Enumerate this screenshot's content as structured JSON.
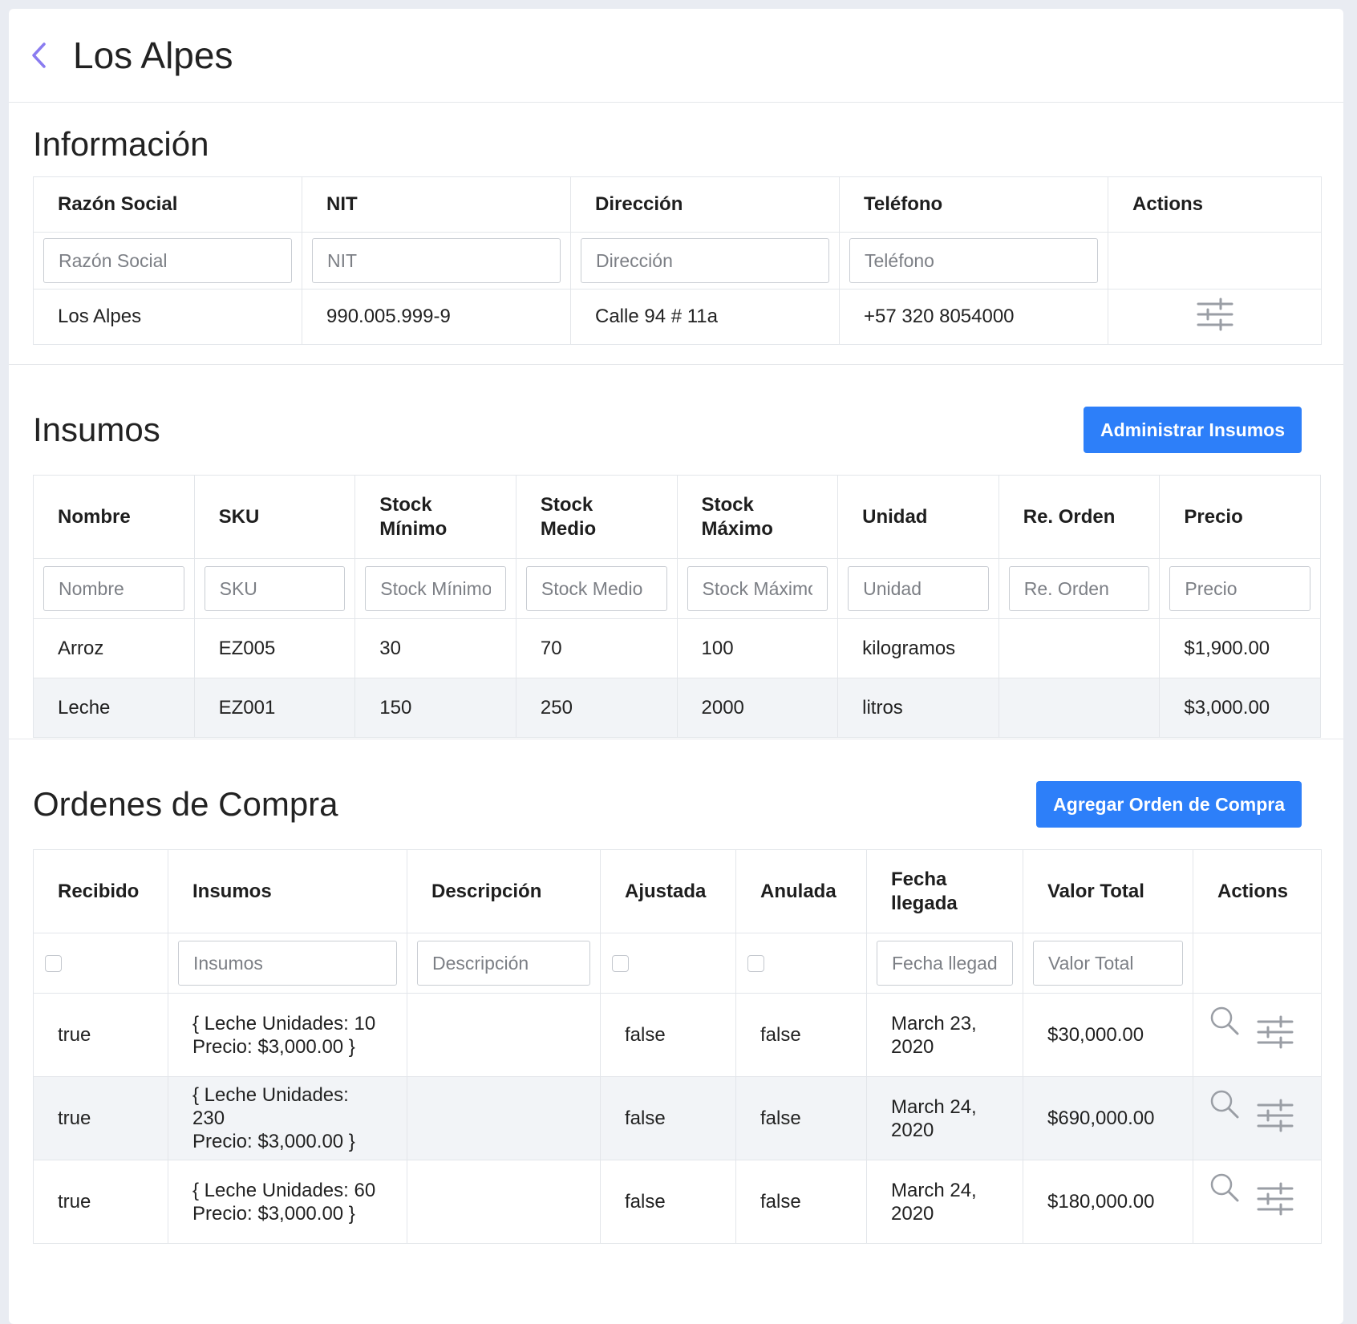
{
  "header": {
    "title": "Los Alpes"
  },
  "info": {
    "heading": "Información",
    "columns": [
      "Razón Social",
      "NIT",
      "Dirección",
      "Teléfono",
      "Actions"
    ],
    "placeholders": [
      "Razón Social",
      "NIT",
      "Dirección",
      "Teléfono"
    ],
    "row": [
      "Los Alpes",
      "990.005.999-9",
      "Calle 94 # 11a",
      "+57 320 8054000"
    ]
  },
  "insumos": {
    "heading": "Insumos",
    "button": "Administrar Insumos",
    "columns": [
      "Nombre",
      "SKU",
      "Stock Mínimo",
      "Stock Medio",
      "Stock Máximo",
      "Unidad",
      "Re. Orden",
      "Precio"
    ],
    "placeholders": [
      "Nombre",
      "SKU",
      "Stock Mínimo",
      "Stock Medio",
      "Stock Máximo",
      "Unidad",
      "Re. Orden",
      "Precio"
    ],
    "rows": [
      [
        "Arroz",
        "EZ005",
        "30",
        "70",
        "100",
        "kilogramos",
        "",
        "$1,900.00"
      ],
      [
        "Leche",
        "EZ001",
        "150",
        "250",
        "2000",
        "litros",
        "",
        "$3,000.00"
      ]
    ]
  },
  "ordenes": {
    "heading": "Ordenes de Compra",
    "button": "Agregar Orden de Compra",
    "columns": [
      "Recibido",
      "Insumos",
      "Descripción",
      "Ajustada",
      "Anulada",
      "Fecha llegada",
      "Valor Total",
      "Actions"
    ],
    "placeholders": {
      "insumos": "Insumos",
      "descripcion": "Descripción",
      "fecha": "Fecha llegada",
      "valor": "Valor Total"
    },
    "rows": [
      {
        "recibido": "true",
        "insumos_1": "{ Leche Unidades: 10",
        "insumos_2": "Precio: $3,000.00 }",
        "descripcion": "",
        "ajustada": "false",
        "anulada": "false",
        "fecha_1": "March 23,",
        "fecha_2": "2020",
        "valor": "$30,000.00"
      },
      {
        "recibido": "true",
        "insumos_1": "{ Leche Unidades: 230",
        "insumos_2": "Precio: $3,000.00 }",
        "descripcion": "",
        "ajustada": "false",
        "anulada": "false",
        "fecha_1": "March 24,",
        "fecha_2": "2020",
        "valor": "$690,000.00"
      },
      {
        "recibido": "true",
        "insumos_1": "{ Leche Unidades: 60",
        "insumos_2": "Precio: $3,000.00 }",
        "descripcion": "",
        "ajustada": "false",
        "anulada": "false",
        "fecha_1": "March 24,",
        "fecha_2": "2020",
        "valor": "$180,000.00"
      }
    ]
  },
  "icons": {
    "back": "chevron-left-icon",
    "adjust": "sliders-icon",
    "view": "search-icon"
  },
  "colors": {
    "accent": "#2d7ff9",
    "back_chevron": "#8a7cf0",
    "icon": "#9a9ea5",
    "stripe": "#f2f4f7"
  }
}
